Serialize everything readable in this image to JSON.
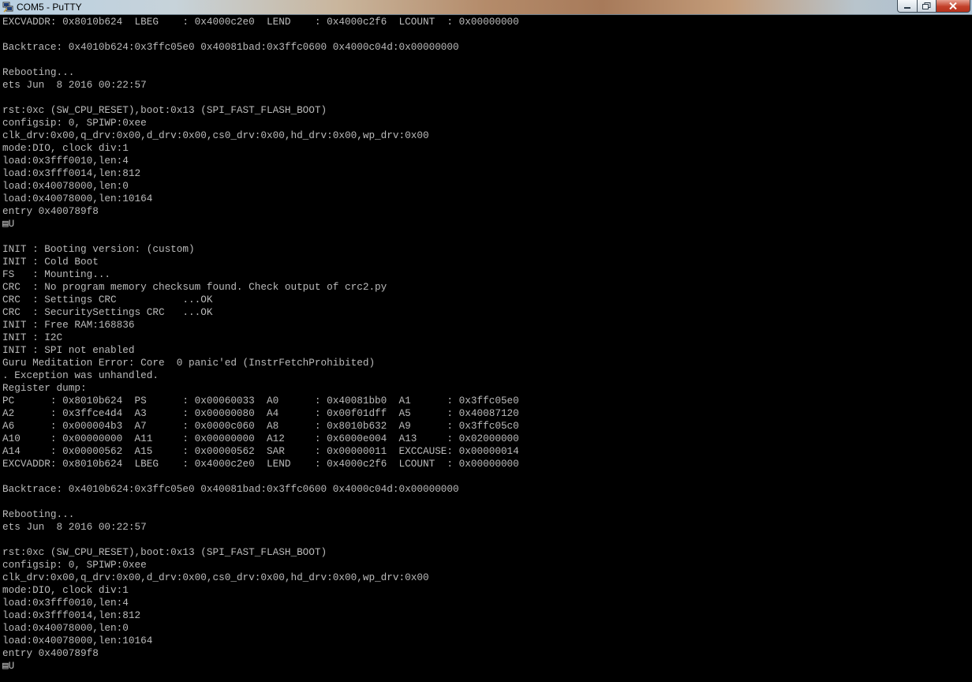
{
  "window": {
    "title": "COM5 - PuTTY",
    "icon": "putty-icon"
  },
  "controls": {
    "minimize_icon": "minimize-icon",
    "maximize_icon": "maximize-icon",
    "close_icon": "close-icon"
  },
  "terminal": {
    "fg_color": "#bbbbbb",
    "bg_color": "#000000",
    "lines": [
      "EXCVADDR: 0x8010b624  LBEG    : 0x4000c2e0  LEND    : 0x4000c2f6  LCOUNT  : 0x00000000",
      "",
      "Backtrace: 0x4010b624:0x3ffc05e0 0x40081bad:0x3ffc0600 0x4000c04d:0x00000000",
      "",
      "Rebooting...",
      "ets Jun  8 2016 00:22:57",
      "",
      "rst:0xc (SW_CPU_RESET),boot:0x13 (SPI_FAST_FLASH_BOOT)",
      "configsip: 0, SPIWP:0xee",
      "clk_drv:0x00,q_drv:0x00,d_drv:0x00,cs0_drv:0x00,hd_drv:0x00,wp_drv:0x00",
      "mode:DIO, clock div:1",
      "load:0x3fff0010,len:4",
      "load:0x3fff0014,len:812",
      "load:0x40078000,len:0",
      "load:0x40078000,len:10164",
      "entry 0x400789f8",
      "▤U",
      "",
      "INIT : Booting version: (custom)",
      "INIT : Cold Boot",
      "FS   : Mounting...",
      "CRC  : No program memory checksum found. Check output of crc2.py",
      "CRC  : Settings CRC           ...OK",
      "CRC  : SecuritySettings CRC   ...OK",
      "INIT : Free RAM:168836",
      "INIT : I2C",
      "INIT : SPI not enabled",
      "Guru Meditation Error: Core  0 panic'ed (InstrFetchProhibited)",
      ". Exception was unhandled.",
      "Register dump:",
      "PC      : 0x8010b624  PS      : 0x00060033  A0      : 0x40081bb0  A1      : 0x3ffc05e0",
      "A2      : 0x3ffce4d4  A3      : 0x00000080  A4      : 0x00f01dff  A5      : 0x40087120",
      "A6      : 0x000004b3  A7      : 0x0000c060  A8      : 0x8010b632  A9      : 0x3ffc05c0",
      "A10     : 0x00000000  A11     : 0x00000000  A12     : 0x6000e004  A13     : 0x02000000",
      "A14     : 0x00000562  A15     : 0x00000562  SAR     : 0x00000011  EXCCAUSE: 0x00000014",
      "EXCVADDR: 0x8010b624  LBEG    : 0x4000c2e0  LEND    : 0x4000c2f6  LCOUNT  : 0x00000000",
      "",
      "Backtrace: 0x4010b624:0x3ffc05e0 0x40081bad:0x3ffc0600 0x4000c04d:0x00000000",
      "",
      "Rebooting...",
      "ets Jun  8 2016 00:22:57",
      "",
      "rst:0xc (SW_CPU_RESET),boot:0x13 (SPI_FAST_FLASH_BOOT)",
      "configsip: 0, SPIWP:0xee",
      "clk_drv:0x00,q_drv:0x00,d_drv:0x00,cs0_drv:0x00,hd_drv:0x00,wp_drv:0x00",
      "mode:DIO, clock div:1",
      "load:0x3fff0010,len:4",
      "load:0x3fff0014,len:812",
      "load:0x40078000,len:0",
      "load:0x40078000,len:10164",
      "entry 0x400789f8",
      "▤U"
    ]
  }
}
